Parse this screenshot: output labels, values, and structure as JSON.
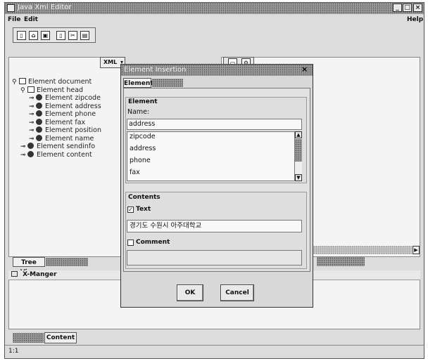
{
  "window": {
    "title": "Java Xml Editor"
  },
  "menu": {
    "file": "File",
    "edit": "Edit",
    "help": "Help"
  },
  "toolbar": {
    "icons": [
      "new-icon",
      "open-icon",
      "save-icon",
      "copy-icon",
      "cut-icon",
      "paste-icon"
    ]
  },
  "left_panel": {
    "combo_value": "XML",
    "tree": [
      {
        "label": "Element document",
        "level": 0,
        "expanded": true,
        "kind": "book"
      },
      {
        "label": "Element head",
        "level": 1,
        "expanded": true,
        "kind": "book"
      },
      {
        "label": "Element zipcode",
        "level": 2,
        "kind": "leaf"
      },
      {
        "label": "Element address",
        "level": 2,
        "kind": "leaf"
      },
      {
        "label": "Element phone",
        "level": 2,
        "kind": "leaf"
      },
      {
        "label": "Element fax",
        "level": 2,
        "kind": "leaf"
      },
      {
        "label": "Element position",
        "level": 2,
        "kind": "leaf"
      },
      {
        "label": "Element name",
        "level": 2,
        "kind": "leaf"
      },
      {
        "label": "Element sendinfo",
        "level": 1,
        "kind": "leaf"
      },
      {
        "label": "Element content",
        "level": 1,
        "kind": "leaf"
      }
    ],
    "tab_tree_view": "Tree View"
  },
  "xmanager": {
    "title": "X-Manger"
  },
  "bottom_tabs": {
    "content": "Content"
  },
  "status": {
    "position": "1:1"
  },
  "dialog": {
    "title": "Element Insertion",
    "tab_element": "Element",
    "element_group": "Element",
    "name_label": "Name:",
    "name_value": "address",
    "list_items": [
      "zipcode",
      "address",
      "phone",
      "fax"
    ],
    "contents_group": "Contents",
    "text_checkbox": "Text",
    "text_checked": true,
    "text_value": "경기도 수원시 아주대학교",
    "comment_checkbox": "Comment",
    "comment_checked": false,
    "ok": "OK",
    "cancel": "Cancel"
  }
}
